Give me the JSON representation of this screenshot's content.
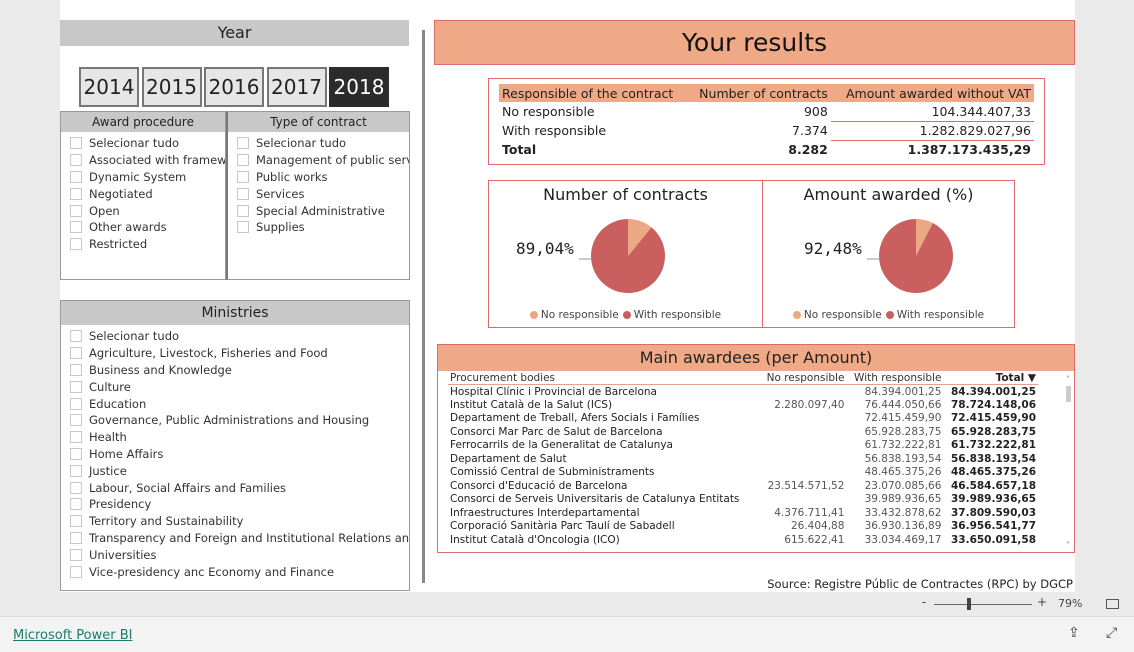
{
  "year": {
    "title": "Year",
    "options": [
      "2014",
      "2015",
      "2016",
      "2017",
      "2018"
    ],
    "selected": "2018"
  },
  "award_procedure": {
    "title": "Award procedure",
    "items": [
      "Selecionar tudo",
      "Associated with framew...",
      "Dynamic System",
      "Negotiated",
      "Open",
      "Other awards",
      "Restricted"
    ]
  },
  "type_of_contract": {
    "title": "Type of contract",
    "items": [
      "Selecionar tudo",
      "Management of public serv...",
      "Public works",
      "Services",
      "Special Administrative",
      "Supplies"
    ]
  },
  "ministries": {
    "title": "Ministries",
    "items": [
      "Selecionar tudo",
      "Agriculture, Livestock, Fisheries and Food",
      "Business and Knowledge",
      "Culture",
      "Education",
      "Governance, Public Administrations and Housing",
      "Health",
      "Home Affairs",
      "Justice",
      "Labour, Social Affairs and Families",
      "Presidency",
      "Territory and Sustainability",
      "Transparency and Foreign and Institutional Relations and Af...",
      "Universities",
      "Vice-presidency anc Economy and Finance"
    ]
  },
  "results": {
    "title": "Your results",
    "headers": [
      "Responsible of the contract",
      "Number of contracts",
      "Amount awarded without VAT"
    ],
    "rows": [
      [
        "No responsible",
        "908",
        "104.344.407,33"
      ],
      [
        "With responsible",
        "7.374",
        "1.282.829.027,96"
      ]
    ],
    "total": [
      "Total",
      "8.282",
      "1.387.173.435,29"
    ]
  },
  "chart_data": [
    {
      "type": "pie",
      "title": "Number of contracts",
      "slices": [
        {
          "name": "No responsible",
          "value": 10.96
        },
        {
          "name": "With responsible",
          "value": 89.04
        }
      ],
      "data_label": "89,04%",
      "legend_placement": "bottom"
    },
    {
      "type": "pie",
      "title": "Amount awarded  (%)",
      "slices": [
        {
          "name": "No responsible",
          "value": 7.52
        },
        {
          "name": "With responsible",
          "value": 92.48
        }
      ],
      "data_label": "92,48%",
      "legend_placement": "bottom"
    }
  ],
  "colors": {
    "no_responsible": "#eba882",
    "with_responsible": "#c95f5f",
    "header": "#f0a987"
  },
  "awardees": {
    "title": "Main awardees (per Amount)",
    "headers": [
      "Procurement bodies",
      "No responsible",
      "With responsible",
      "Total"
    ],
    "rows": [
      [
        "Hospital Clínic i Provincial de Barcelona",
        "",
        "84.394.001,25",
        "84.394.001,25"
      ],
      [
        "Institut Català de la Salut (ICS)",
        "2.280.097,40",
        "76.444.050,66",
        "78.724.148,06"
      ],
      [
        "Departament de Treball, Afers Socials i Famílies",
        "",
        "72.415.459,90",
        "72.415.459,90"
      ],
      [
        "Consorci Mar Parc de Salut de Barcelona",
        "",
        "65.928.283,75",
        "65.928.283,75"
      ],
      [
        "Ferrocarrils de la Generalitat de Catalunya",
        "",
        "61.732.222,81",
        "61.732.222,81"
      ],
      [
        "Departament de Salut",
        "",
        "56.838.193,54",
        "56.838.193,54"
      ],
      [
        "Comissió Central de Subministraments",
        "",
        "48.465.375,26",
        "48.465.375,26"
      ],
      [
        "Consorci d'Educació de Barcelona",
        "23.514.571,52",
        "23.070.085,66",
        "46.584.657,18"
      ],
      [
        "Consorci de Serveis Universitaris de Catalunya Entitats",
        "",
        "39.989.936,65",
        "39.989.936,65"
      ],
      [
        "Infraestructures Interdepartamental",
        "4.376.711,41",
        "33.432.878,62",
        "37.809.590,03"
      ],
      [
        "Corporació Sanitària Parc Taulí de Sabadell",
        "26.404,88",
        "36.930.136,89",
        "36.956.541,77"
      ],
      [
        "Institut Català d'Oncologia (ICO)",
        "615.622,41",
        "33.034.469,17",
        "33.650.091,58"
      ]
    ]
  },
  "source": "Source: Registre Públic de Contractes (RPC) by DGCP",
  "zoom": {
    "value": "79%",
    "minus": "-",
    "plus": "+"
  },
  "footer": {
    "brand": "Microsoft Power BI"
  }
}
